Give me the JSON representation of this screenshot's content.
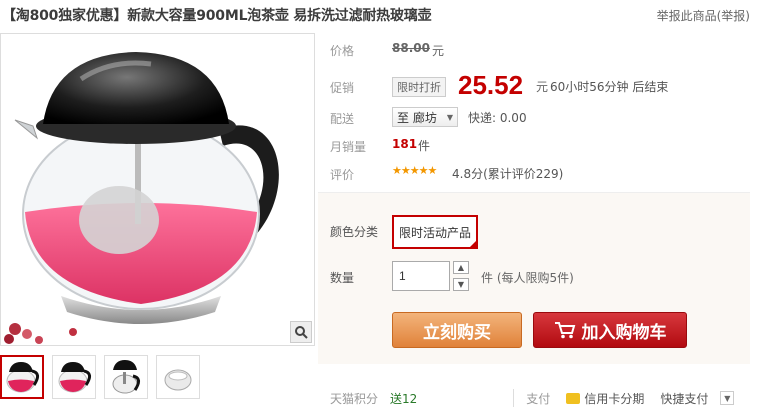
{
  "header": {
    "title": "【淘800独家优惠】新款大容量900ML泡茶壶 易拆洗过滤耐热玻璃壶",
    "report_link": "举报此商品(举报)"
  },
  "product": {
    "zoom_icon": "magnifier-icon"
  },
  "info": {
    "price_label": "价格",
    "original_price": "88.00",
    "price_unit": "元",
    "promo_label": "促销",
    "promo_tag": "限时打折",
    "promo_price": "25.52",
    "promo_unit": "元",
    "countdown": "60小时56分钟 后结束",
    "ship_label": "配送",
    "ship_to": "至 廊坊",
    "ship_fee": "快递: 0.00",
    "sales_label": "月销量",
    "sales_count": "181",
    "sales_unit": "件",
    "review_label": "评价",
    "stars": "★★★★★",
    "rating": "4.8分(累计评价229)"
  },
  "buybox": {
    "color_label": "颜色分类",
    "sku_option": "限时活动产品",
    "qty_label": "数量",
    "qty_value": "1",
    "qty_note": "件 (每人限购5件)",
    "buy_now": "立刻购买",
    "add_cart": "加入购物车"
  },
  "footer": {
    "points_label": "天猫积分",
    "points_value": "送12",
    "pay_label": "支付",
    "credit_installment": "信用卡分期",
    "quick_pay": "快捷支付"
  },
  "colors": {
    "accent": "#c40000",
    "buy_button": "#e58a42",
    "cart_button": "#c0161b"
  }
}
